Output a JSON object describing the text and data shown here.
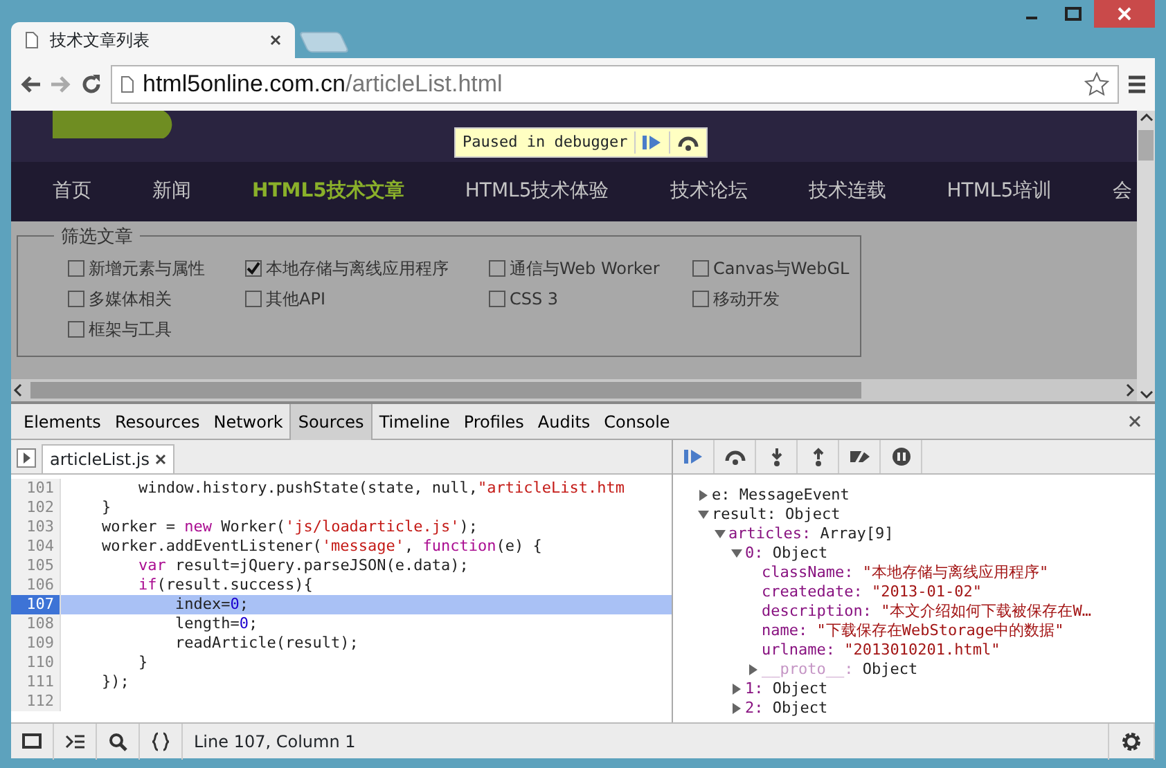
{
  "browser": {
    "tab_title": "技术文章列表",
    "url_host": "html5online.com.cn",
    "url_path": "/articleList.html"
  },
  "debugger_banner": {
    "text": "Paused in debugger"
  },
  "nav": [
    {
      "label": "首页",
      "selected": false
    },
    {
      "label": "新闻",
      "selected": false
    },
    {
      "label": "HTML5技术文章",
      "selected": true
    },
    {
      "label": "HTML5技术体验",
      "selected": false
    },
    {
      "label": "技术论坛",
      "selected": false
    },
    {
      "label": "技术连载",
      "selected": false
    },
    {
      "label": "HTML5培训",
      "selected": false
    },
    {
      "label": "会",
      "selected": false
    }
  ],
  "filter": {
    "legend": "筛选文章",
    "options": [
      {
        "label": "新增元素与属性",
        "checked": false
      },
      {
        "label": "本地存储与离线应用程序",
        "checked": true
      },
      {
        "label": "通信与Web Worker",
        "checked": false
      },
      {
        "label": "Canvas与WebGL",
        "checked": false
      },
      {
        "label": "多媒体相关",
        "checked": false
      },
      {
        "label": "其他API",
        "checked": false
      },
      {
        "label": "CSS 3",
        "checked": false
      },
      {
        "label": "移动开发",
        "checked": false
      },
      {
        "label": "框架与工具",
        "checked": false
      }
    ]
  },
  "devtools": {
    "tabs": [
      {
        "label": "Elements",
        "selected": false
      },
      {
        "label": "Resources",
        "selected": false
      },
      {
        "label": "Network",
        "selected": false
      },
      {
        "label": "Sources",
        "selected": true
      },
      {
        "label": "Timeline",
        "selected": false
      },
      {
        "label": "Profiles",
        "selected": false
      },
      {
        "label": "Audits",
        "selected": false
      },
      {
        "label": "Console",
        "selected": false
      }
    ],
    "file_tab": "articleList.js",
    "code": [
      {
        "n": "101",
        "current": false,
        "tokens": [
          {
            "kind": "plain",
            "text": "        window.history.pushState(state, null,"
          },
          {
            "kind": "string",
            "text": "\"articleList.htm"
          }
        ]
      },
      {
        "n": "102",
        "current": false,
        "tokens": [
          {
            "kind": "plain",
            "text": "    }"
          }
        ]
      },
      {
        "n": "103",
        "current": false,
        "tokens": [
          {
            "kind": "plain",
            "text": "    worker = "
          },
          {
            "kind": "keyword",
            "text": "new"
          },
          {
            "kind": "plain",
            "text": " Worker("
          },
          {
            "kind": "string",
            "text": "'js/loadarticle.js'"
          },
          {
            "kind": "plain",
            "text": ");"
          }
        ]
      },
      {
        "n": "104",
        "current": false,
        "tokens": [
          {
            "kind": "plain",
            "text": "    worker.addEventListener("
          },
          {
            "kind": "string",
            "text": "'message'"
          },
          {
            "kind": "plain",
            "text": ", "
          },
          {
            "kind": "keyword",
            "text": "function"
          },
          {
            "kind": "plain",
            "text": "(e) {"
          }
        ]
      },
      {
        "n": "105",
        "current": false,
        "tokens": [
          {
            "kind": "keyword",
            "text": "        var"
          },
          {
            "kind": "plain",
            "text": " result=jQuery.parseJSON(e.data);"
          }
        ]
      },
      {
        "n": "106",
        "current": false,
        "tokens": [
          {
            "kind": "keyword",
            "text": "        if"
          },
          {
            "kind": "plain",
            "text": "(result.success){"
          }
        ]
      },
      {
        "n": "107",
        "current": true,
        "tokens": [
          {
            "kind": "plain",
            "text": "            index="
          },
          {
            "kind": "number",
            "text": "0"
          },
          {
            "kind": "plain",
            "text": ";"
          }
        ]
      },
      {
        "n": "108",
        "current": false,
        "tokens": [
          {
            "kind": "plain",
            "text": "            length="
          },
          {
            "kind": "number",
            "text": "0"
          },
          {
            "kind": "plain",
            "text": ";"
          }
        ]
      },
      {
        "n": "109",
        "current": false,
        "tokens": [
          {
            "kind": "plain",
            "text": "            readArticle(result);"
          }
        ]
      },
      {
        "n": "110",
        "current": false,
        "tokens": [
          {
            "kind": "plain",
            "text": "        }"
          }
        ]
      },
      {
        "n": "111",
        "current": false,
        "tokens": [
          {
            "kind": "plain",
            "text": "    });"
          }
        ]
      },
      {
        "n": "112",
        "current": false
      }
    ],
    "status": "Line 107, Column 1",
    "scope": [
      {
        "key": "e:",
        "value": "MessageEvent",
        "expanded": false
      },
      {
        "key": "result:",
        "value": "Object",
        "expanded": true,
        "children": [
          {
            "key": "articles:",
            "value": "Array[9]",
            "expanded": true,
            "children": [
              {
                "key": "0:",
                "value": "Object",
                "expanded": true,
                "children": [
                  {
                    "key": "className:",
                    "value": "\"本地存储与离线应用程序\"",
                    "kind": "string"
                  },
                  {
                    "key": "createdate:",
                    "value": "\"2013-01-02\"",
                    "kind": "string"
                  },
                  {
                    "key": "description:",
                    "value": "\"本文介绍如何下载被保存在W…",
                    "kind": "string"
                  },
                  {
                    "key": "name:",
                    "value": "\"下载保存在WebStorage中的数据\"",
                    "kind": "string"
                  },
                  {
                    "key": "urlname:",
                    "value": "\"2013010201.html\"",
                    "kind": "string"
                  },
                  {
                    "key": "__proto__:",
                    "value": "Object",
                    "expanded": false,
                    "kind": "object"
                  }
                ]
              },
              {
                "key": "1:",
                "value": "Object",
                "expanded": false
              },
              {
                "key": "2:",
                "value": "Object",
                "expanded": false
              }
            ]
          }
        ]
      }
    ]
  }
}
